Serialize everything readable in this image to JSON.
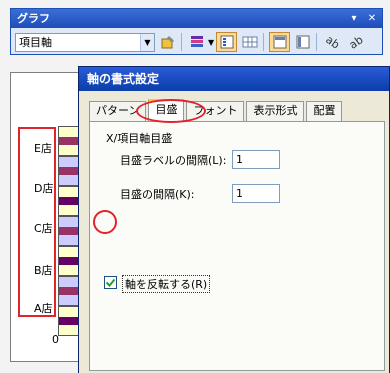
{
  "toolbar": {
    "title": "グラフ",
    "controls": [
      "▾",
      "✕"
    ],
    "select_value": "項目軸"
  },
  "chart": {
    "categories": [
      "E店",
      "D店",
      "C店",
      "B店",
      "A店"
    ],
    "zero_label": "0"
  },
  "dialog": {
    "title": "軸の書式設定",
    "tabs": [
      "パターン",
      "目盛",
      "フォント",
      "表示形式",
      "配置"
    ],
    "active_tab": "目盛",
    "section_label": "X/項目軸目盛",
    "fields": [
      {
        "label": "目盛ラベルの間隔(L):",
        "value": "1"
      },
      {
        "label": "目盛の間隔(K):",
        "value": "1"
      }
    ],
    "reverse_checkbox": {
      "label": "軸を反転する(R)",
      "checked": true
    }
  },
  "colors": {
    "annotation_red": "#e0242a",
    "title_blue": "#1f4db8"
  }
}
